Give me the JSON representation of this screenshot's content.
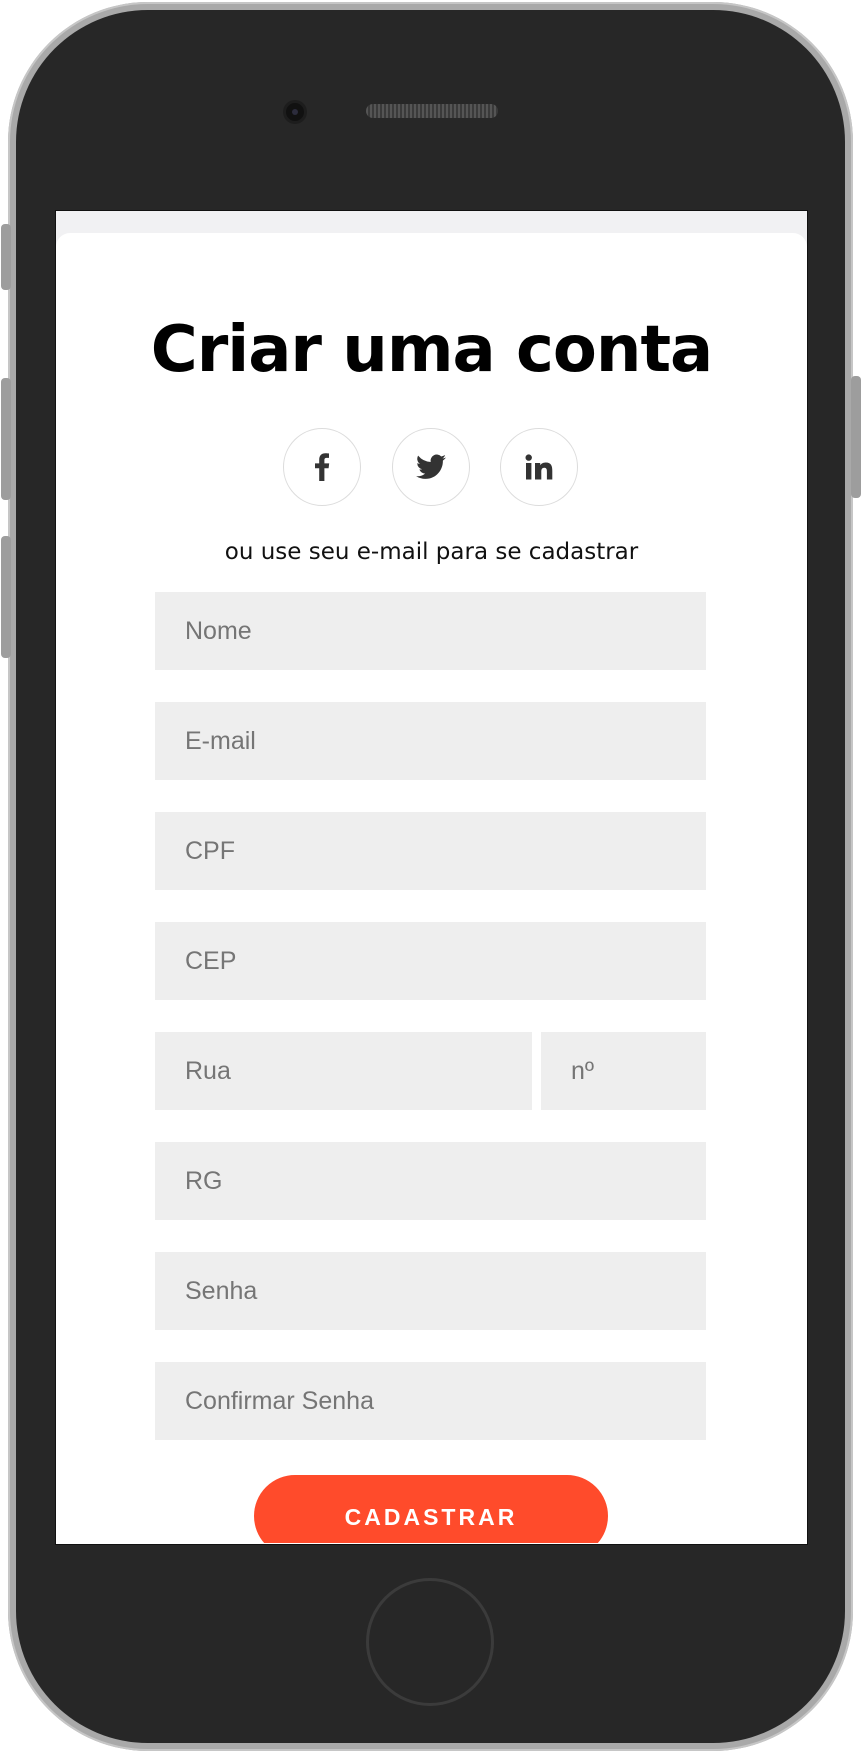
{
  "form": {
    "title": "Criar uma conta",
    "subtitle": "ou use seu e-mail para se cadastrar",
    "social": [
      {
        "icon": "facebook-icon"
      },
      {
        "icon": "twitter-icon"
      },
      {
        "icon": "linkedin-icon"
      }
    ],
    "fields": {
      "nome": {
        "placeholder": "Nome",
        "value": ""
      },
      "email": {
        "placeholder": "E-mail",
        "value": ""
      },
      "cpf": {
        "placeholder": "CPF",
        "value": ""
      },
      "cep": {
        "placeholder": "CEP",
        "value": ""
      },
      "rua": {
        "placeholder": "Rua",
        "value": ""
      },
      "numero": {
        "placeholder": "nº",
        "value": ""
      },
      "rg": {
        "placeholder": "RG",
        "value": ""
      },
      "senha": {
        "placeholder": "Senha",
        "value": ""
      },
      "confirmar_senha": {
        "placeholder": "Confirmar Senha",
        "value": ""
      }
    },
    "submit_label": "CADASTRAR"
  },
  "colors": {
    "accent": "#ff4b2b",
    "field_bg": "#eeeeee",
    "device_body": "#272727",
    "device_frame": "#a9a9a9"
  }
}
